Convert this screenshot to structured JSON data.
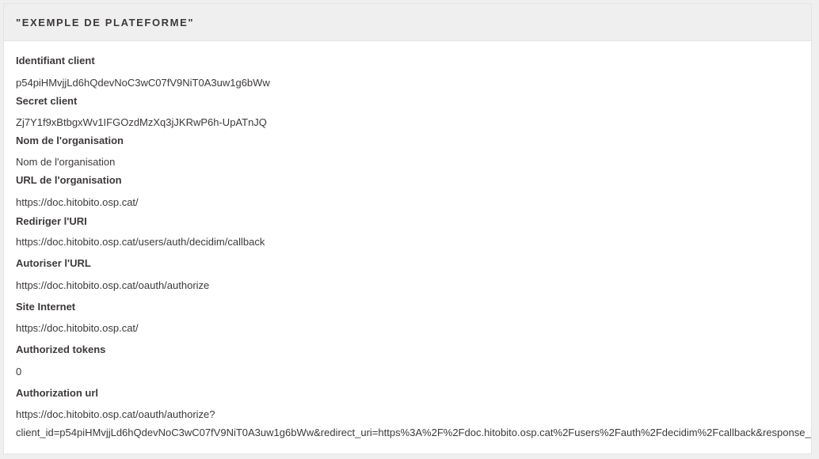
{
  "card": {
    "title": "\"EXEMPLE DE PLATEFORME\""
  },
  "fields": [
    {
      "label": "Identifiant client",
      "value": "p54piHMvjjLd6hQdevNoC3wC07fV9NiT0A3uw1g6bWw"
    },
    {
      "label": "Secret client",
      "value": "Zj7Y1f9xBtbgxWv1IFGOzdMzXq3jJKRwP6h-UpATnJQ"
    },
    {
      "label": "Nom de l'organisation",
      "value": "Nom de l'organisation"
    },
    {
      "label": "URL de l'organisation",
      "value": "https://doc.hitobito.osp.cat/"
    },
    {
      "label": "Rediriger l'URI",
      "value": "https://doc.hitobito.osp.cat/users/auth/decidim/callback"
    },
    {
      "label": "Autoriser l'URL",
      "value": "https://doc.hitobito.osp.cat/oauth/authorize"
    },
    {
      "label": "Site Internet",
      "value": "https://doc.hitobito.osp.cat/"
    },
    {
      "label": "Authorized tokens",
      "value": "0"
    },
    {
      "label": "Authorization url",
      "value": "https://doc.hitobito.osp.cat/oauth/authorize?",
      "value_line2": "client_id=p54piHMvjjLd6hQdevNoC3wC07fV9NiT0A3uw1g6bWw&redirect_uri=https%3A%2F%2Fdoc.hitobito.osp.cat%2Fusers%2Fauth%2Fdecidim%2Fcallback&response_type=code&scope=public"
    }
  ]
}
